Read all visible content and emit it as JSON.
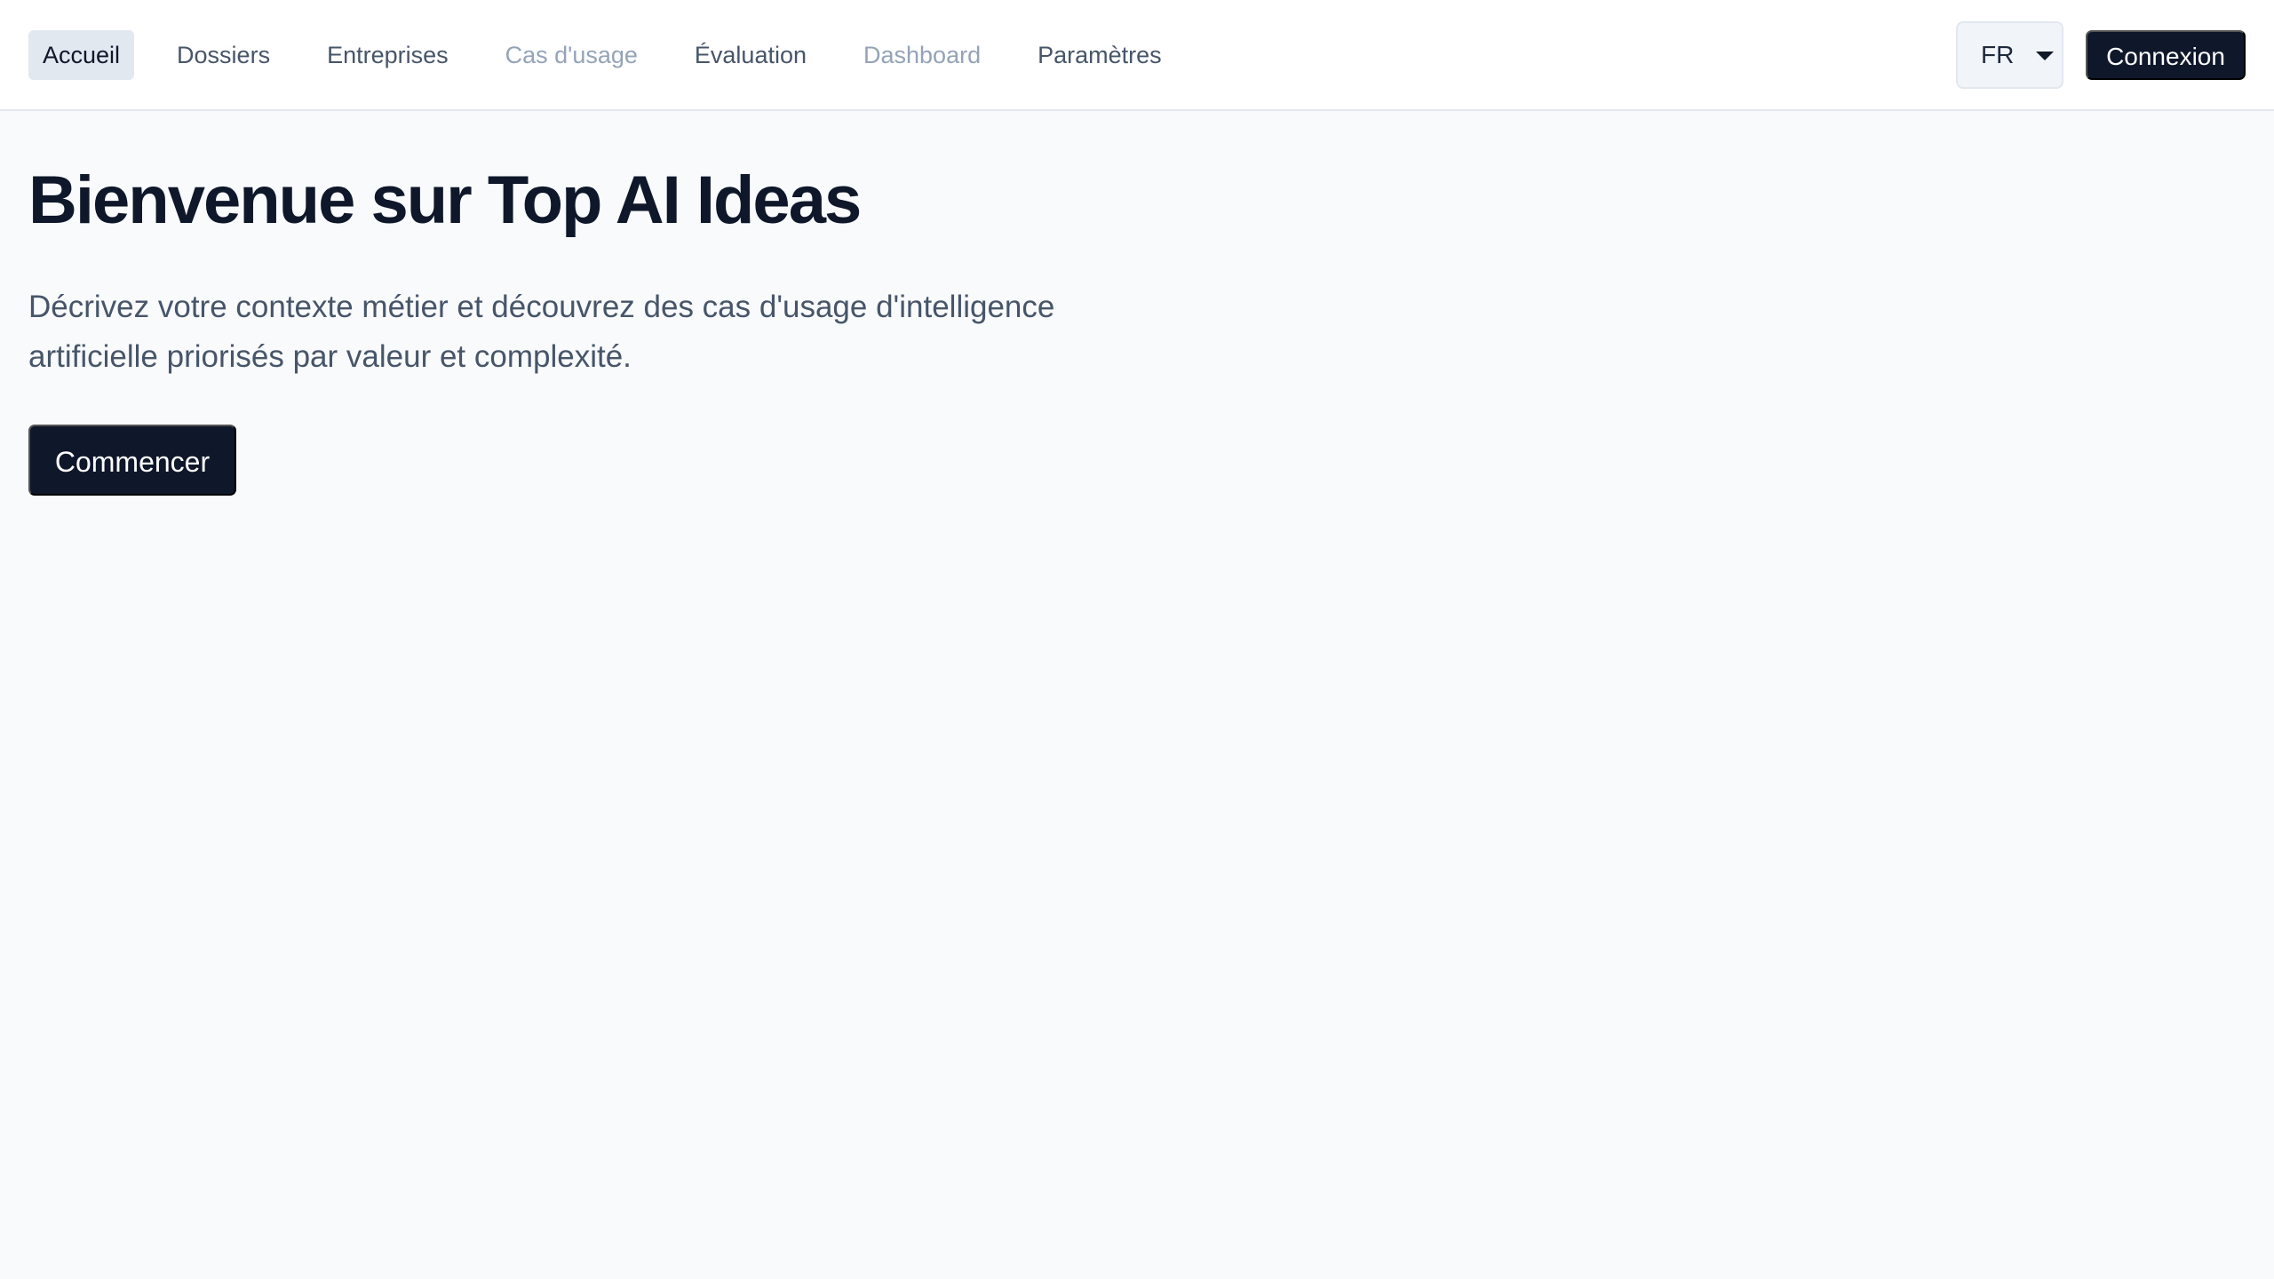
{
  "nav": {
    "items": [
      {
        "label": "Accueil",
        "state": "active"
      },
      {
        "label": "Dossiers",
        "state": "normal"
      },
      {
        "label": "Entreprises",
        "state": "normal"
      },
      {
        "label": "Cas d'usage",
        "state": "disabled"
      },
      {
        "label": "Évaluation",
        "state": "normal"
      },
      {
        "label": "Dashboard",
        "state": "disabled"
      },
      {
        "label": "Paramètres",
        "state": "normal"
      }
    ]
  },
  "header": {
    "language": {
      "selected": "FR",
      "icon": "chevron-down-icon"
    },
    "login_label": "Connexion"
  },
  "hero": {
    "title": "Bienvenue sur Top AI Ideas",
    "subtitle": "Décrivez votre contexte métier et découvrez des cas d'usage d'intelligence artificielle priorisés par valeur et complexité.",
    "cta_label": "Commencer"
  },
  "colors": {
    "page_background": "#f8fafc",
    "primary": "#0f172a",
    "muted_text": "#475569",
    "disabled_text": "#94a3b8",
    "active_nav_background": "#e2e8f0"
  }
}
